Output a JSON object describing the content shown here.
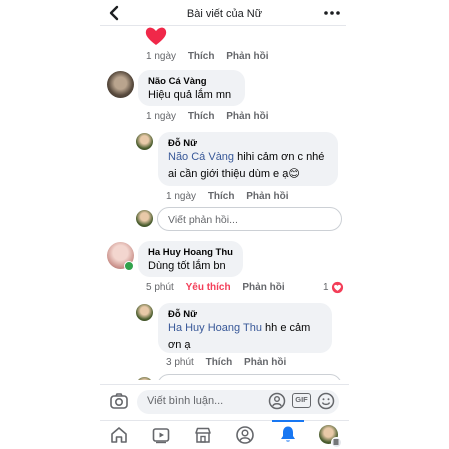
{
  "header": {
    "title": "Bài viết của Nữ",
    "back_icon": "chevron-left-icon",
    "more_icon": "more-dots-icon"
  },
  "top_meta": {
    "time": "1 ngày",
    "like": "Thích",
    "reply": "Phản hồi"
  },
  "comments": [
    {
      "author": "Não Cá Vàng",
      "text": "Hiệu quả lắm mn",
      "time": "1 ngày",
      "like": "Thích",
      "reply": "Phản hồi"
    },
    {
      "author": "Đỗ Nữ",
      "mention": "Não Cá Vàng",
      "text_line1": " hihi cảm ơn c nhé",
      "text_line2": "ai cần giới thiệu dùm e ạ😊",
      "time": "1 ngày",
      "like": "Thích",
      "reply": "Phản hồi"
    },
    {
      "author": "Ha Huy Hoang Thu",
      "text": "Dùng tốt lắm bn",
      "time": "5 phút",
      "like": "Yêu thích",
      "reply": "Phản hồi",
      "like_count": "1"
    },
    {
      "author": "Đỗ Nữ",
      "mention": "Ha Huy Hoang Thu",
      "text_line1": "  hh e cảm",
      "text_line2": "ơn ạ",
      "time": "3 phút",
      "like": "Thích",
      "reply": "Phản hồi"
    }
  ],
  "reply_placeholder": "Viết phản hồi...",
  "composer": {
    "placeholder": "Viết bình luận...",
    "gif_label": "GIF"
  },
  "colors": {
    "accent": "#1877f2",
    "like_active": "#f33e58",
    "mention": "#385898",
    "bubble": "#f0f2f5"
  },
  "nav": [
    "home-icon",
    "video-icon",
    "marketplace-icon",
    "profile-icon",
    "notifications-icon",
    "menu-avatar"
  ]
}
